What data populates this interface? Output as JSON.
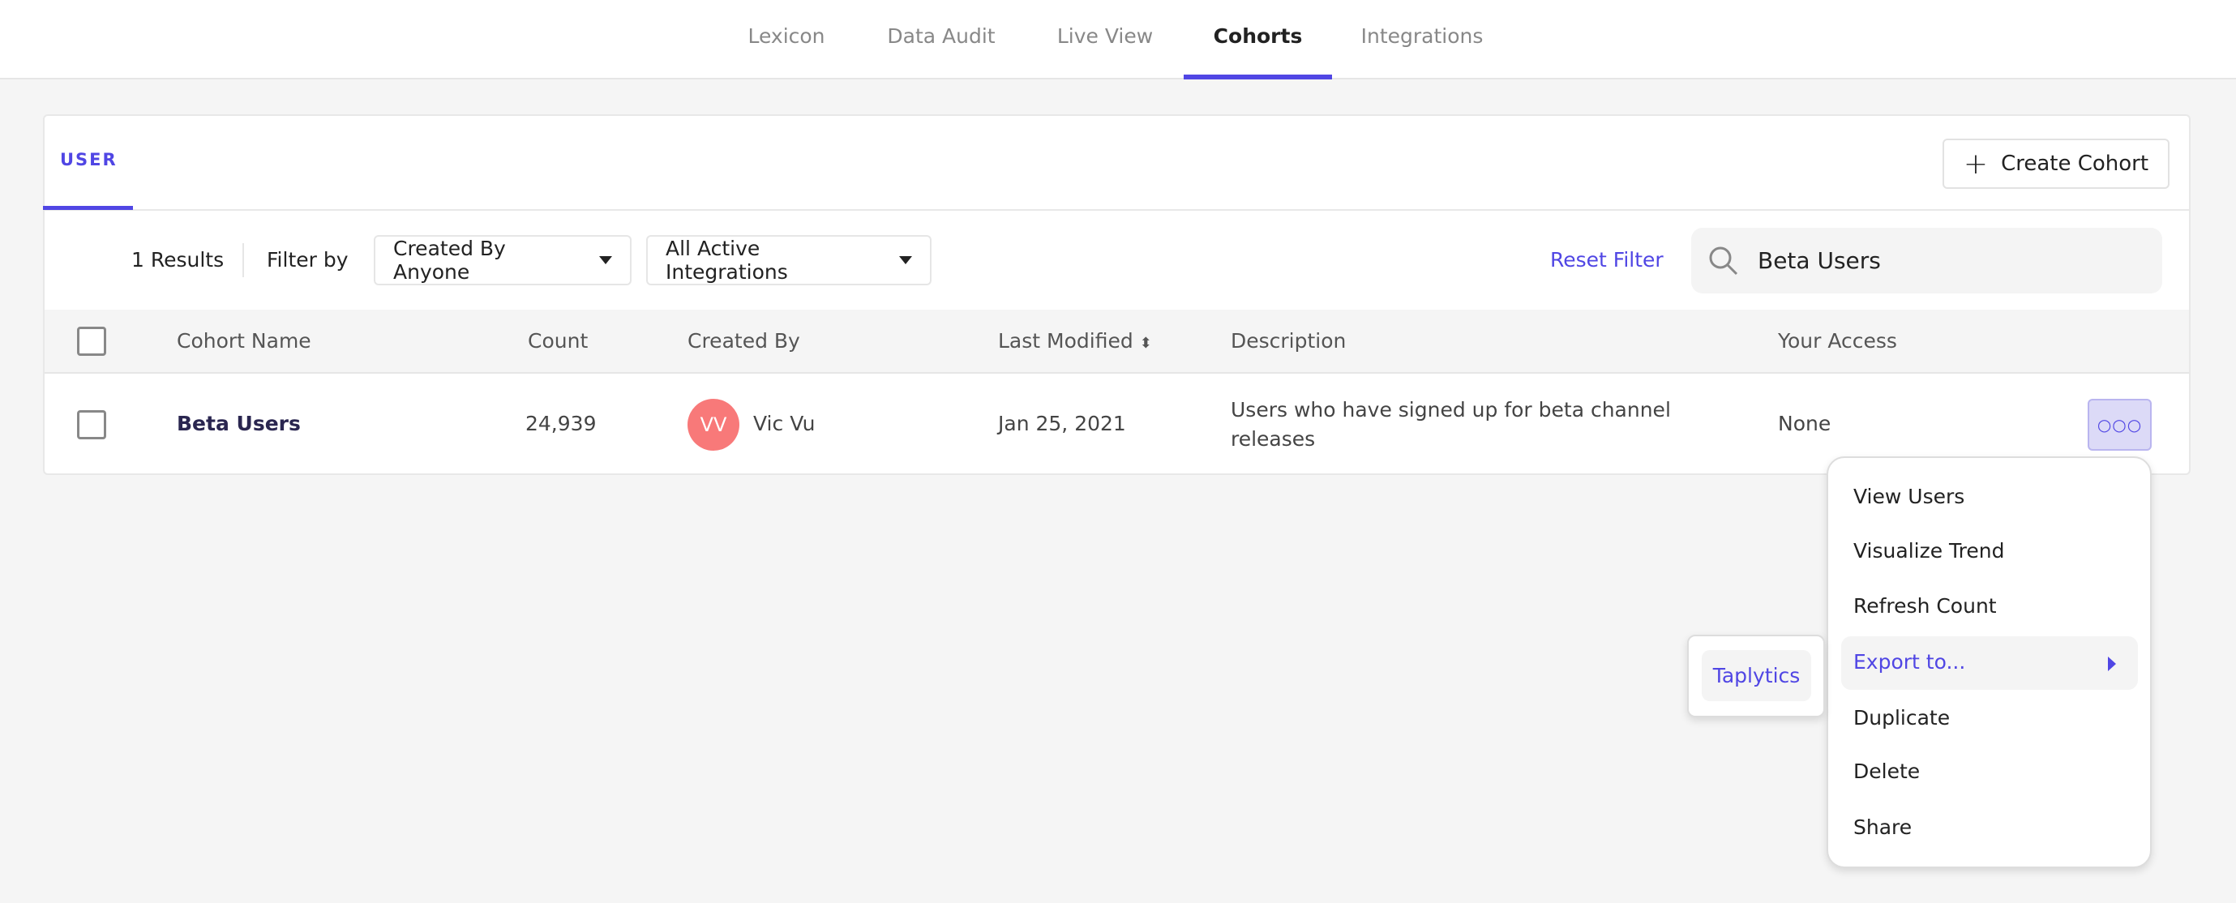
{
  "nav": {
    "tabs": [
      "Lexicon",
      "Data Audit",
      "Live View",
      "Cohorts",
      "Integrations"
    ],
    "active": "Cohorts"
  },
  "card": {
    "tab": "USER",
    "create_label": "Create Cohort"
  },
  "filters": {
    "results": "1 Results",
    "filter_by": "Filter by",
    "created_by": "Created By Anyone",
    "integrations": "All Active Integrations",
    "reset": "Reset Filter",
    "search_value": "Beta Users"
  },
  "table": {
    "columns": [
      "Cohort Name",
      "Count",
      "Created By",
      "Last Modified",
      "Description",
      "Your Access"
    ],
    "rows": [
      {
        "name": "Beta Users",
        "count": "24,939",
        "avatar_initials": "VV",
        "created_by": "Vic Vu",
        "last_modified": "Jan 25, 2021",
        "description": "Users who have signed up for beta channel releases",
        "access": "None"
      }
    ]
  },
  "menu": {
    "items": [
      "View Users",
      "Visualize Trend",
      "Refresh Count",
      "Export to...",
      "Duplicate",
      "Delete",
      "Share"
    ],
    "highlighted": "Export to..."
  },
  "submenu": {
    "items": [
      "Taplytics"
    ]
  },
  "colors": {
    "accent": "#5046e4",
    "avatar": "#f87979"
  }
}
